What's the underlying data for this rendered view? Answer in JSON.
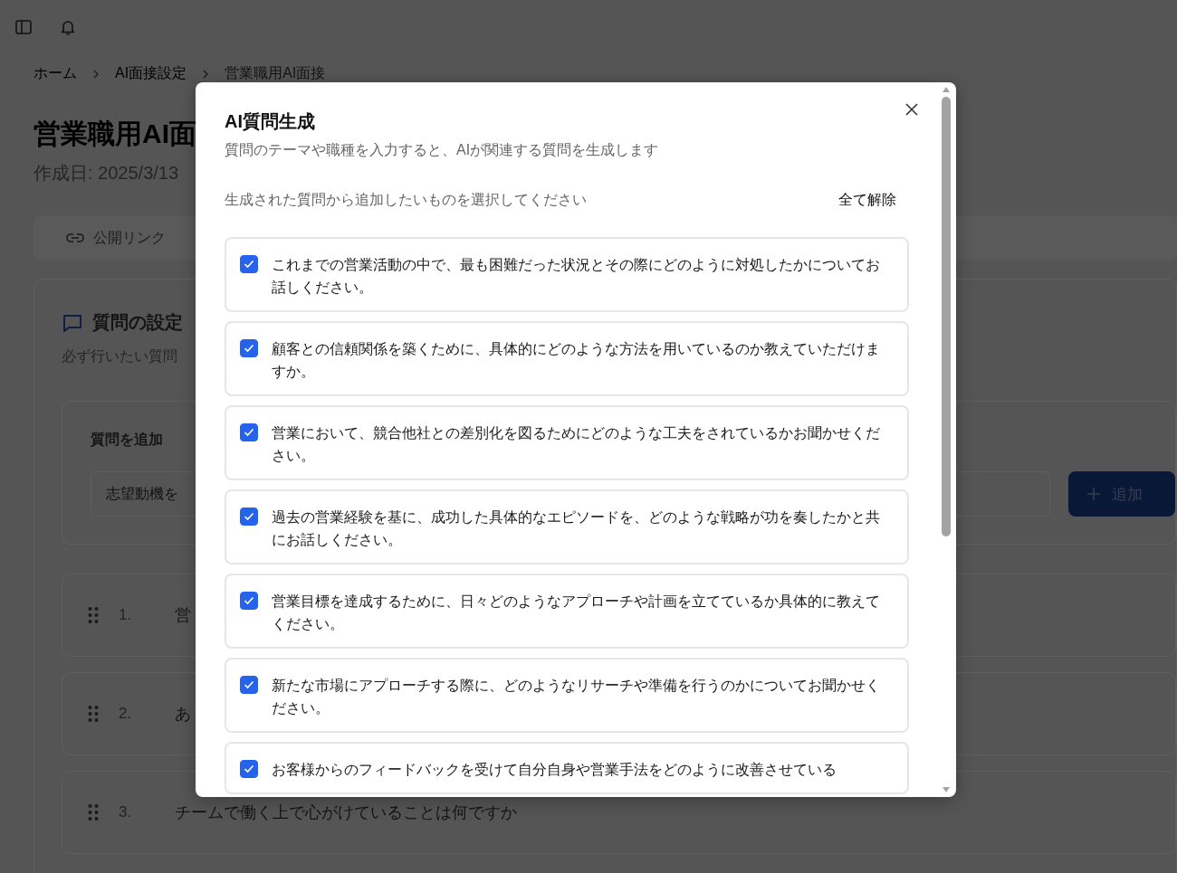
{
  "breadcrumb": [
    "ホーム",
    "AI面接設定",
    "営業職用AI面接"
  ],
  "page": {
    "title": "営業職用AI面",
    "created": "作成日: 2025/3/13",
    "public_link": "公開リンク"
  },
  "question_settings": {
    "title": "質問の設定",
    "description": "必ず行いたい質問",
    "add_label": "質問を追加",
    "input_placeholder": "志望動機を",
    "add_button": "追加"
  },
  "questions": [
    {
      "number": "1.",
      "text": "営"
    },
    {
      "number": "2.",
      "text": "あ"
    },
    {
      "number": "3.",
      "text": "チームで働く上で心がけていることは何ですか"
    }
  ],
  "modal": {
    "title": "AI質問生成",
    "description": "質問のテーマや職種を入力すると、AIが関連する質問を生成します",
    "instruction": "生成された質問から追加したいものを選択してください",
    "clear_all": "全て解除",
    "items": [
      {
        "text": "これまでの営業活動の中で、最も困難だった状況とその際にどのように対処したかについてお話しください。",
        "checked": true
      },
      {
        "text": "顧客との信頼関係を築くために、具体的にどのような方法を用いているのか教えていただけますか。",
        "checked": true
      },
      {
        "text": "営業において、競合他社との差別化を図るためにどのような工夫をされているかお聞かせください。",
        "checked": true
      },
      {
        "text": "過去の営業経験を基に、成功した具体的なエピソードを、どのような戦略が功を奏したかと共にお話しください。",
        "checked": true
      },
      {
        "text": "営業目標を達成するために、日々どのようなアプローチや計画を立てているか具体的に教えてください。",
        "checked": true
      },
      {
        "text": "新たな市場にアプローチする際に、どのようなリサーチや準備を行うのかについてお聞かせください。",
        "checked": true
      },
      {
        "text": "お客様からのフィードバックを受けて自分自身や営業手法をどのように改善させている",
        "checked": true
      }
    ]
  }
}
